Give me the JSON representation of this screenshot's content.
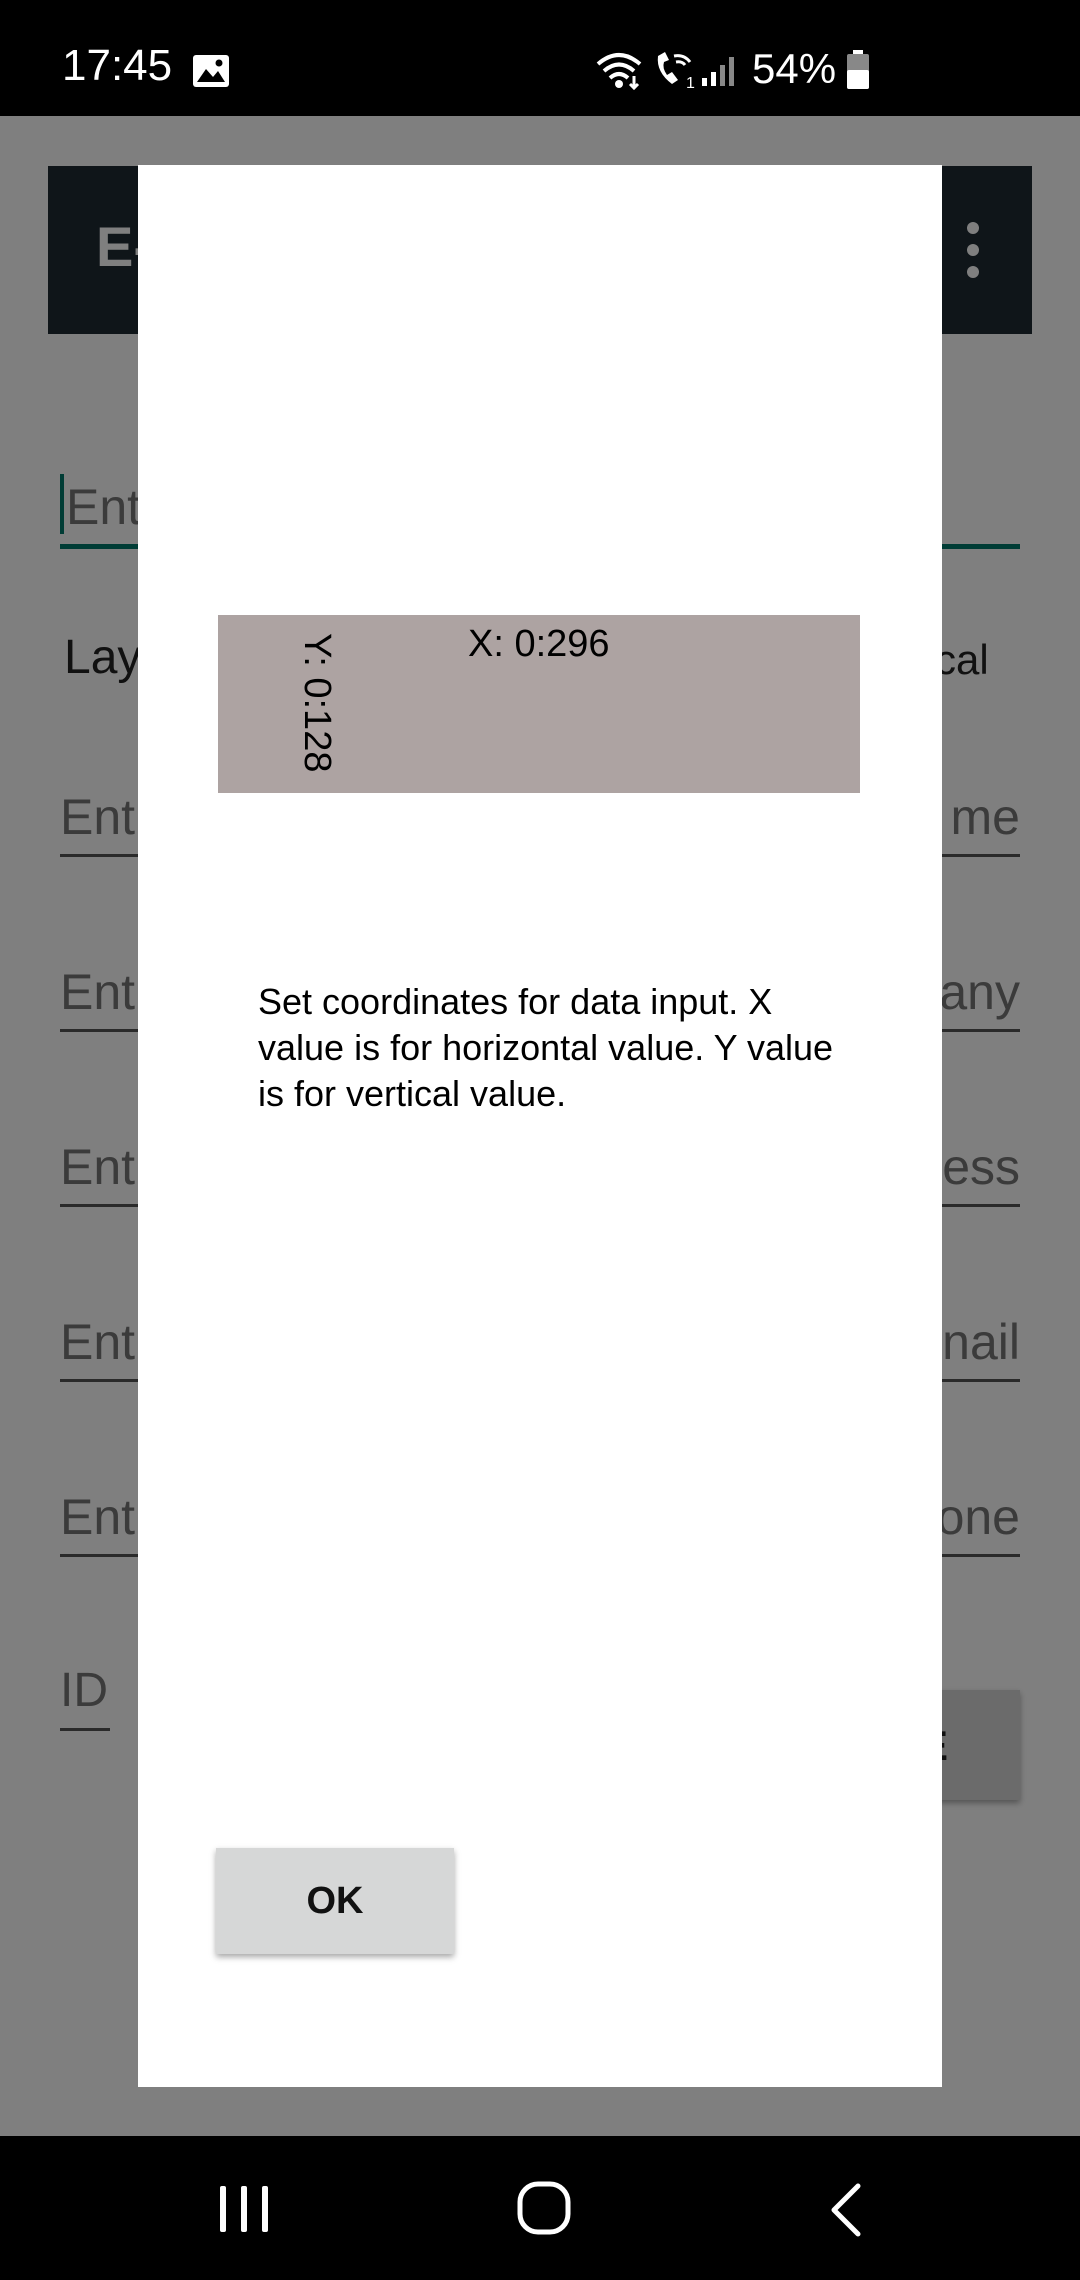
{
  "status_bar": {
    "time": "17:45",
    "battery": "54%",
    "icons": [
      "gallery-icon",
      "wifi-icon",
      "wifi-call-icon",
      "signal-icon",
      "battery-icon"
    ]
  },
  "background_app": {
    "title_partial": "E-",
    "layout_label": "Lay",
    "vertical_label": "rtical",
    "fields": [
      {
        "placeholder_left": "Ent",
        "placeholder_right": ""
      },
      {
        "placeholder_left": "Ent",
        "placeholder_right": "me"
      },
      {
        "placeholder_left": "Ent",
        "placeholder_right": "any"
      },
      {
        "placeholder_left": "Ent",
        "placeholder_right": "ess"
      },
      {
        "placeholder_left": "Ent",
        "placeholder_right": "nail"
      },
      {
        "placeholder_left": "Ent",
        "placeholder_right": "one"
      }
    ],
    "id_placeholder": "ID",
    "button_partial": "E"
  },
  "dialog": {
    "x_label": "X: 0:296",
    "y_label": "Y: 0:128",
    "message": "Set coordinates for data input. X value is for horizontal value. Y value is for vertical value.",
    "ok_label": "OK"
  },
  "colors": {
    "app_bar": "#1e2b33",
    "accent": "#00796b",
    "coord_box": "#ada3a2",
    "button": "#d6d7d7"
  }
}
